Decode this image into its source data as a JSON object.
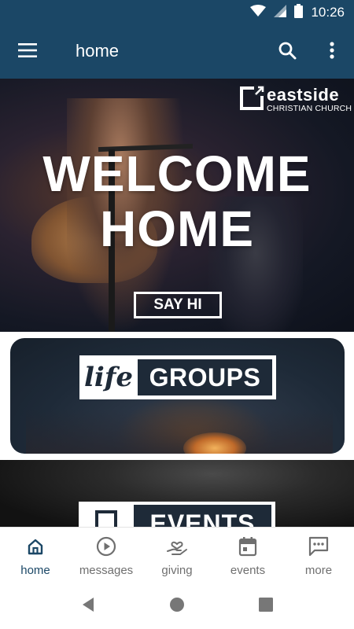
{
  "status_bar": {
    "time": "10:26",
    "icons": [
      "wifi-icon",
      "signal-icon",
      "battery-icon"
    ]
  },
  "app_bar": {
    "title": "home",
    "icons": [
      "menu-icon",
      "search-icon",
      "more-vert-icon"
    ],
    "background": "#1b4766"
  },
  "hero": {
    "logo_name": "eastside",
    "logo_subtitle": "CHRISTIAN CHURCH",
    "title_line1": "WELCOME",
    "title_line2": "HOME",
    "cta_label": "SAY HI"
  },
  "cards": {
    "life_groups": {
      "script_word": "life",
      "title": "GROUPS"
    },
    "events": {
      "title": "EVENTS"
    }
  },
  "bottom_nav": {
    "items": [
      {
        "label": "home",
        "icon": "home-icon",
        "active": true
      },
      {
        "label": "messages",
        "icon": "play-circle-icon",
        "active": false
      },
      {
        "label": "giving",
        "icon": "giving-hand-heart-icon",
        "active": false
      },
      {
        "label": "events",
        "icon": "calendar-icon",
        "active": false
      },
      {
        "label": "more",
        "icon": "chat-bubble-more-icon",
        "active": false
      }
    ],
    "active_color": "#1b4766",
    "inactive_color": "#6f6f6f"
  },
  "system_nav": {
    "icons": [
      "back-icon",
      "home-circle-icon",
      "recents-icon"
    ]
  }
}
